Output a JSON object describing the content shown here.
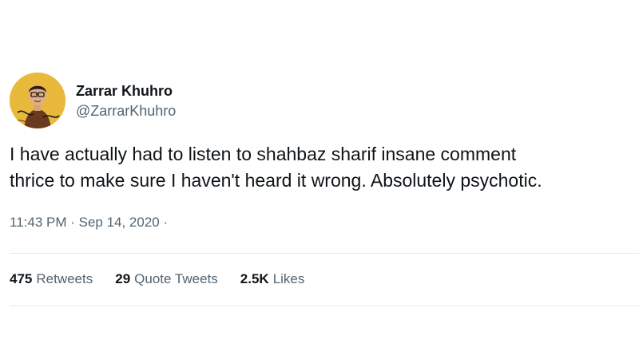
{
  "author": {
    "display_name": "Zarrar Khuhro",
    "handle": "@ZarrarKhuhro",
    "avatar_icon": "profile-avatar-caricature",
    "avatar_bg": "#e9b93c"
  },
  "tweet": {
    "text_lines": [
      "I have actually had to listen to shahbaz sharif insane comment",
      "thrice to make sure I haven't heard it wrong. Absolutely psychotic."
    ],
    "time": "11:43 PM",
    "date": "Sep 14, 2020",
    "meta_line": "11:43 PM · Sep 14, 2020 ·"
  },
  "stats": [
    {
      "count": "475",
      "label": "Retweets"
    },
    {
      "count": "29",
      "label": "Quote Tweets"
    },
    {
      "count": "2.5K",
      "label": "Likes"
    }
  ],
  "colors": {
    "primary_text": "#0f1419",
    "secondary_text": "#536471",
    "divider": "#e1e8ed"
  }
}
